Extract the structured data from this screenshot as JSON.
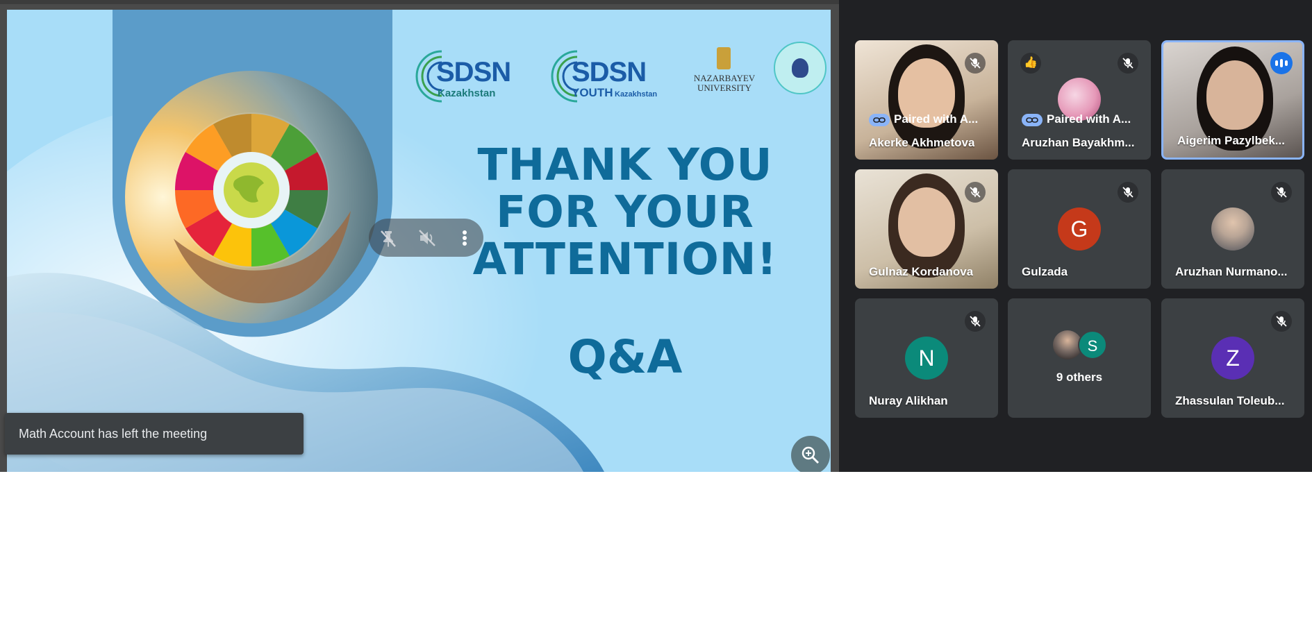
{
  "presentation": {
    "logos": {
      "sdsn_kz": {
        "big": "SDSN",
        "sub": "Kazakhstan"
      },
      "sdsn_youth": {
        "big": "SDSN",
        "sub": "YOUTH",
        "sub_small": "Kazakhstan"
      },
      "nazarbayev": {
        "line1": "NAZARBAYEV",
        "line2": "UNIVERSITY"
      }
    },
    "title_lines": [
      "THANK YOU",
      "FOR YOUR",
      "ATTENTION!"
    ],
    "qa": "Q&A",
    "colors": {
      "title": "#0f6b9a",
      "slide_bg": "#a6dcf7"
    }
  },
  "toast": {
    "text": "Math Account has left the meeting"
  },
  "participants": [
    {
      "name": "Akerke Akhmetova",
      "paired": "Paired with A...",
      "muted": true
    },
    {
      "name": "Aruzhan Bayakhm...",
      "paired": "Paired with A...",
      "muted": true,
      "reaction": "👍"
    },
    {
      "name": "Aigerim Pazylbek...",
      "speaking": true
    },
    {
      "name": "Gulnaz Kordanova",
      "muted": true
    },
    {
      "name": "Gulzada",
      "initial": "G",
      "muted": true,
      "color": "#c5391a"
    },
    {
      "name": "Aruzhan Nurmano...",
      "muted": true
    },
    {
      "name": "Nuray Alikhan",
      "initial": "N",
      "muted": true,
      "color": "#0b8a7a"
    },
    {
      "name": "9 others",
      "initial": "S",
      "color": "#0b8a7a"
    },
    {
      "name": "Zhassulan Toleub...",
      "initial": "Z",
      "muted": true,
      "color": "#5a2fb4"
    }
  ]
}
